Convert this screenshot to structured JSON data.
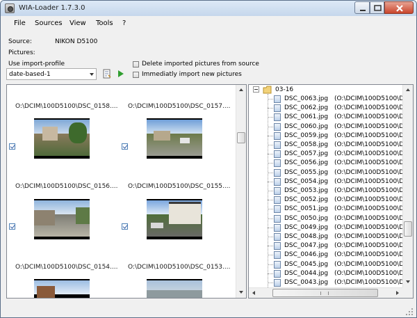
{
  "window": {
    "title": "WIA-Loader 1.7.3.0"
  },
  "menu": [
    "File",
    "Sources",
    "View",
    "Tools",
    "?"
  ],
  "source": {
    "label": "Source:",
    "value": "NIKON D5100"
  },
  "pictures": {
    "label": "Pictures:"
  },
  "profile": {
    "label": "Use import-profile",
    "selected": "date-based-1"
  },
  "options": {
    "delete_label": "Delete imported pictures from source",
    "delete_checked": false,
    "immediate_label": "Immediatly import new pictures",
    "immediate_checked": false
  },
  "thumbnails": [
    {
      "path": "O:\\DCIM\\100D5100\\DSC_0158....",
      "checked": true,
      "scene": "hillside town with trees"
    },
    {
      "path": "O:\\DCIM\\100D5100\\DSC_0157....",
      "checked": true,
      "scene": "road with car and houses"
    },
    {
      "path": "O:\\DCIM\\100D5100\\DSC_0156....",
      "checked": true,
      "scene": "empty street with wall"
    },
    {
      "path": "O:\\DCIM\\100D5100\\DSC_0155....",
      "checked": true,
      "scene": "timbered house with car"
    },
    {
      "path": "O:\\DCIM\\100D5100\\DSC_0154....",
      "checked": false,
      "scene": "rooftops and sky"
    },
    {
      "path": "O:\\DCIM\\100D5100\\DSC_0153....",
      "checked": false,
      "scene": "distant city view"
    }
  ],
  "tree": {
    "folder": "03-16",
    "files": [
      {
        "name": "DSC_0063.jpg",
        "path": "(O:\\DCIM\\100D5100\\D"
      },
      {
        "name": "DSC_0062.jpg",
        "path": "(O:\\DCIM\\100D5100\\D"
      },
      {
        "name": "DSC_0061.jpg",
        "path": "(O:\\DCIM\\100D5100\\D"
      },
      {
        "name": "DSC_0060.jpg",
        "path": "(O:\\DCIM\\100D5100\\D"
      },
      {
        "name": "DSC_0059.jpg",
        "path": "(O:\\DCIM\\100D5100\\D"
      },
      {
        "name": "DSC_0058.jpg",
        "path": "(O:\\DCIM\\100D5100\\D"
      },
      {
        "name": "DSC_0057.jpg",
        "path": "(O:\\DCIM\\100D5100\\D"
      },
      {
        "name": "DSC_0056.jpg",
        "path": "(O:\\DCIM\\100D5100\\D"
      },
      {
        "name": "DSC_0055.jpg",
        "path": "(O:\\DCIM\\100D5100\\D"
      },
      {
        "name": "DSC_0054.jpg",
        "path": "(O:\\DCIM\\100D5100\\D"
      },
      {
        "name": "DSC_0053.jpg",
        "path": "(O:\\DCIM\\100D5100\\D"
      },
      {
        "name": "DSC_0052.jpg",
        "path": "(O:\\DCIM\\100D5100\\D"
      },
      {
        "name": "DSC_0051.jpg",
        "path": "(O:\\DCIM\\100D5100\\D"
      },
      {
        "name": "DSC_0050.jpg",
        "path": "(O:\\DCIM\\100D5100\\D"
      },
      {
        "name": "DSC_0049.jpg",
        "path": "(O:\\DCIM\\100D5100\\D"
      },
      {
        "name": "DSC_0048.jpg",
        "path": "(O:\\DCIM\\100D5100\\D"
      },
      {
        "name": "DSC_0047.jpg",
        "path": "(O:\\DCIM\\100D5100\\D"
      },
      {
        "name": "DSC_0046.jpg",
        "path": "(O:\\DCIM\\100D5100\\D"
      },
      {
        "name": "DSC_0045.jpg",
        "path": "(O:\\DCIM\\100D5100\\D"
      },
      {
        "name": "DSC_0044.jpg",
        "path": "(O:\\DCIM\\100D5100\\D"
      },
      {
        "name": "DSC_0043.jpg",
        "path": "(O:\\DCIM\\100D5100\\D"
      }
    ]
  },
  "colors": {
    "title_bar": "#c5d7ec",
    "close_button": "#c9452b",
    "play_icon": "#2f9e2f"
  }
}
